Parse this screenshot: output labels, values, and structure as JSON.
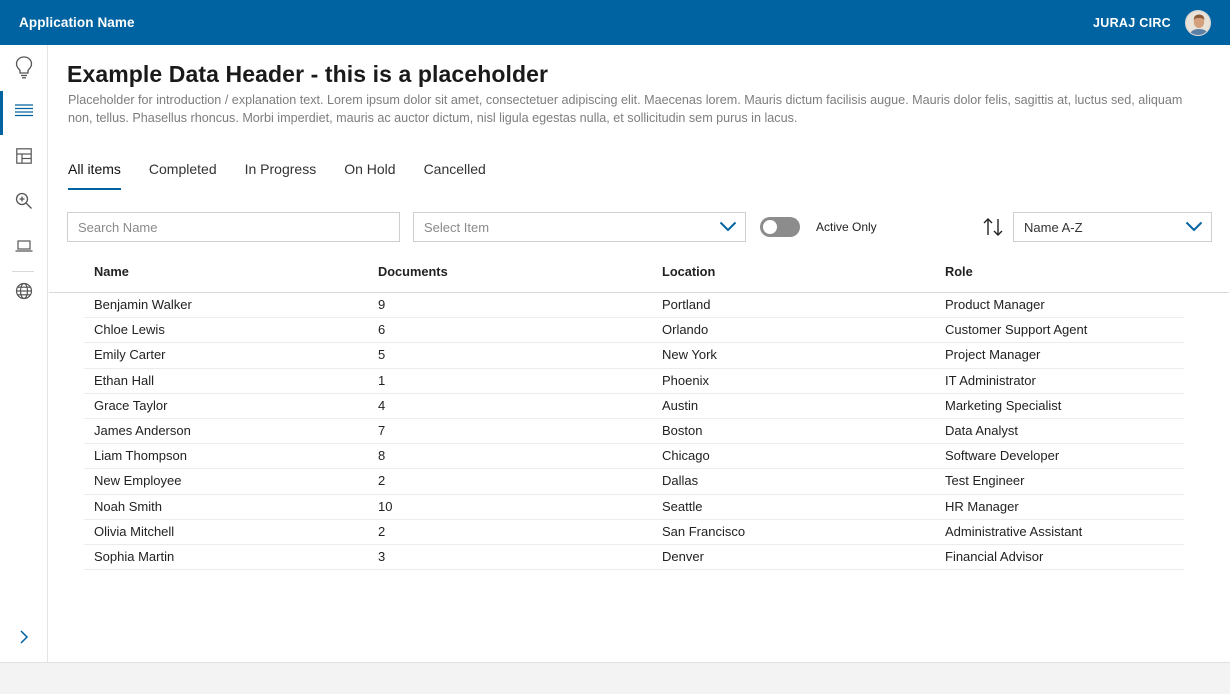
{
  "app": {
    "name": "Application Name"
  },
  "user": {
    "name": "JURAJ CIRC"
  },
  "sidebar": {
    "items": [
      {
        "icon": "lightbulb-icon"
      },
      {
        "icon": "list-icon",
        "active": true
      },
      {
        "icon": "layout-icon"
      },
      {
        "icon": "zoom-icon"
      },
      {
        "icon": "laptop-icon"
      },
      {
        "icon": "globe-icon"
      }
    ],
    "expand_icon": "chevron-right-icon"
  },
  "page": {
    "title": "Example Data Header - this is a placeholder",
    "intro": "Placeholder for introduction / explanation text. Lorem ipsum dolor sit amet, consectetuer adipiscing elit. Maecenas lorem. Mauris dictum facilisis augue. Mauris dolor felis, sagittis at, luctus sed, aliquam non, tellus. Phasellus rhoncus. Morbi imperdiet, mauris ac auctor dictum, nisl ligula egestas nulla, et sollicitudin sem purus in lacus."
  },
  "tabs": [
    "All items",
    "Completed",
    "In Progress",
    "On Hold",
    "Cancelled"
  ],
  "filters": {
    "search_placeholder": "Search Name",
    "select_placeholder": "Select Item",
    "toggle_label": "Active Only",
    "toggle_on": false,
    "sort_value": "Name A-Z"
  },
  "colors": {
    "brand": "#0063a1"
  },
  "table": {
    "columns": [
      "Name",
      "Documents",
      "Location",
      "Role"
    ],
    "rows": [
      [
        "Benjamin Walker",
        "9",
        "Portland",
        "Product Manager"
      ],
      [
        "Chloe Lewis",
        "6",
        "Orlando",
        "Customer Support Agent"
      ],
      [
        "Emily Carter",
        "5",
        "New York",
        "Project Manager"
      ],
      [
        "Ethan Hall",
        "1",
        "Phoenix",
        "IT Administrator"
      ],
      [
        "Grace Taylor",
        "4",
        "Austin",
        "Marketing Specialist"
      ],
      [
        "James Anderson",
        "7",
        "Boston",
        "Data Analyst"
      ],
      [
        "Liam Thompson",
        "8",
        "Chicago",
        "Software Developer"
      ],
      [
        "New Employee",
        "2",
        "Dallas",
        "Test Engineer"
      ],
      [
        "Noah Smith",
        "10",
        "Seattle",
        "HR Manager"
      ],
      [
        "Olivia Mitchell",
        "2",
        "San Francisco",
        "Administrative Assistant"
      ],
      [
        "Sophia Martin",
        "3",
        "Denver",
        "Financial Advisor"
      ]
    ]
  }
}
